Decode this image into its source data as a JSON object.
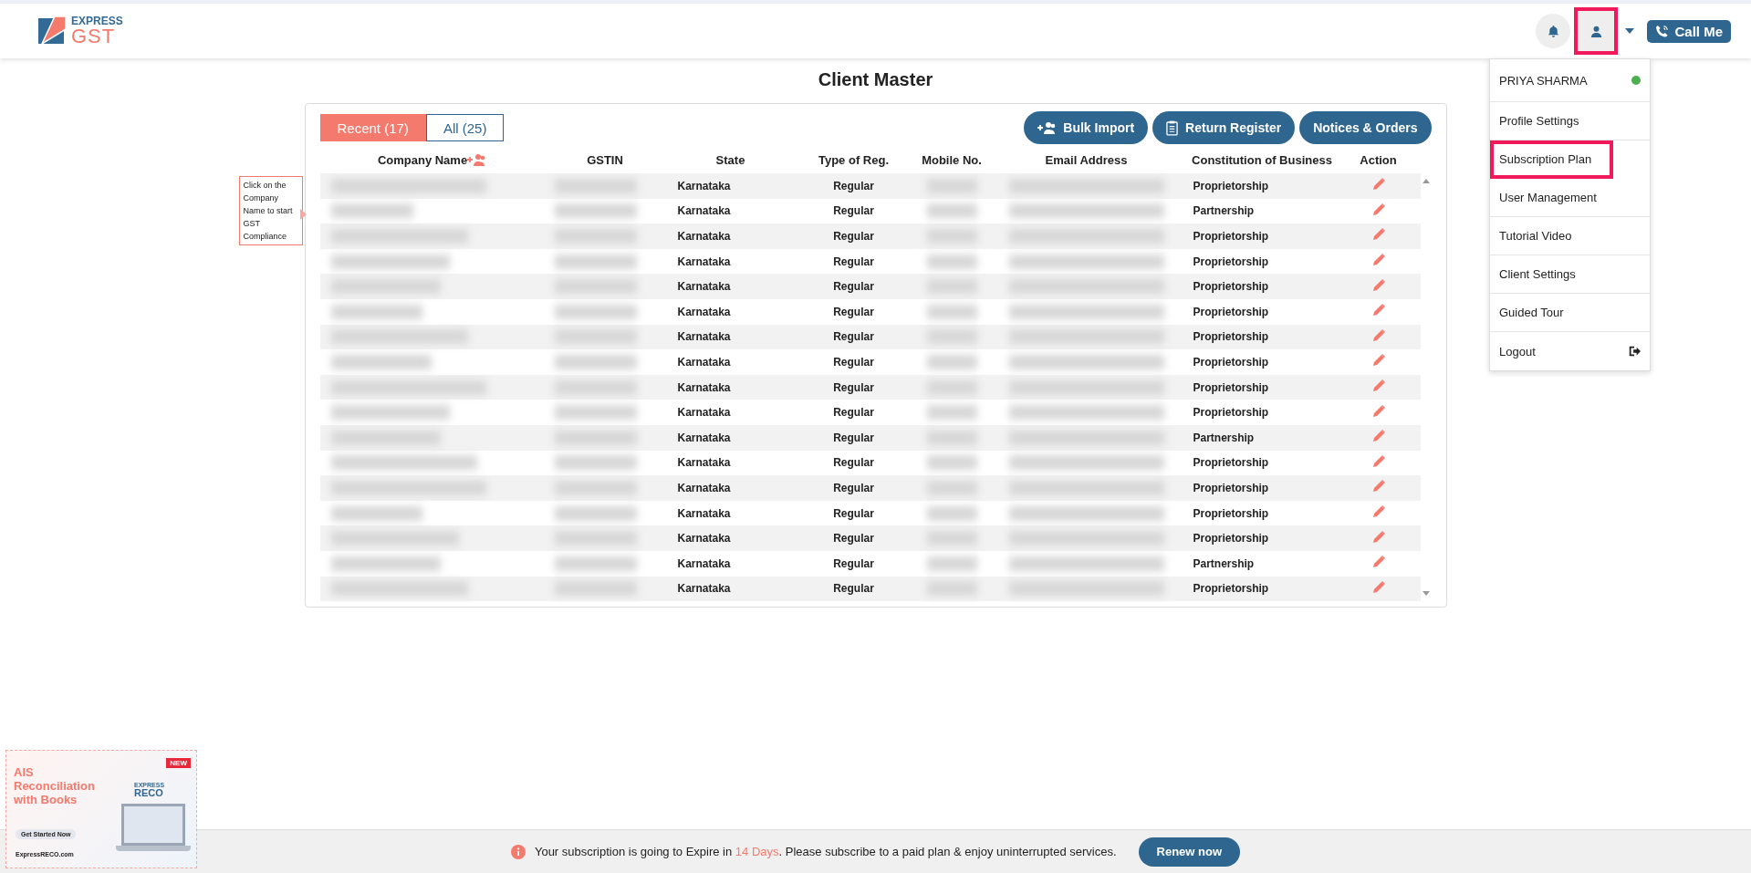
{
  "header": {
    "logo": {
      "top": "EXPRESS",
      "bottom": "GST"
    },
    "user_button": {
      "highlighted": true
    },
    "call_button": "Call Me"
  },
  "user_menu": {
    "name": "PRIYA SHARMA",
    "online": true,
    "items": [
      {
        "label": "Profile Settings",
        "highlighted": false,
        "kind": "link"
      },
      {
        "label": "Subscription Plan",
        "highlighted": true,
        "kind": "link"
      },
      {
        "label": "User Management",
        "highlighted": false,
        "kind": "link"
      },
      {
        "label": "Tutorial Video",
        "highlighted": false,
        "kind": "link"
      },
      {
        "label": "Client Settings",
        "highlighted": false,
        "kind": "link"
      },
      {
        "label": "Guided Tour",
        "highlighted": false,
        "kind": "link"
      },
      {
        "label": "Logout",
        "highlighted": false,
        "kind": "logout"
      }
    ]
  },
  "page_title": "Client Master",
  "tabs": [
    {
      "label": "Recent (17)",
      "selected": true
    },
    {
      "label": "All (25)",
      "selected": false
    }
  ],
  "actions": [
    {
      "label": "Bulk Import",
      "kind": "import"
    },
    {
      "label": "Return Register",
      "kind": "register"
    },
    {
      "label": "Notices & Orders",
      "kind": "plain"
    }
  ],
  "hint": "Click on the Company Name to start GST Compliance",
  "table": {
    "columns": [
      "Company Name",
      "GSTIN",
      "State",
      "Type of Reg.",
      "Mobile No.",
      "Email Address",
      "Constitution of Business",
      "Action"
    ],
    "rows": [
      {
        "state": "Karnataka",
        "type": "Regular",
        "constitution": "Proprietorship"
      },
      {
        "state": "Karnataka",
        "type": "Regular",
        "constitution": "Partnership"
      },
      {
        "state": "Karnataka",
        "type": "Regular",
        "constitution": "Proprietorship"
      },
      {
        "state": "Karnataka",
        "type": "Regular",
        "constitution": "Proprietorship"
      },
      {
        "state": "Karnataka",
        "type": "Regular",
        "constitution": "Proprietorship"
      },
      {
        "state": "Karnataka",
        "type": "Regular",
        "constitution": "Proprietorship"
      },
      {
        "state": "Karnataka",
        "type": "Regular",
        "constitution": "Proprietorship"
      },
      {
        "state": "Karnataka",
        "type": "Regular",
        "constitution": "Proprietorship"
      },
      {
        "state": "Karnataka",
        "type": "Regular",
        "constitution": "Proprietorship"
      },
      {
        "state": "Karnataka",
        "type": "Regular",
        "constitution": "Proprietorship"
      },
      {
        "state": "Karnataka",
        "type": "Regular",
        "constitution": "Partnership"
      },
      {
        "state": "Karnataka",
        "type": "Regular",
        "constitution": "Proprietorship"
      },
      {
        "state": "Karnataka",
        "type": "Regular",
        "constitution": "Proprietorship"
      },
      {
        "state": "Karnataka",
        "type": "Regular",
        "constitution": "Proprietorship"
      },
      {
        "state": "Karnataka",
        "type": "Regular",
        "constitution": "Proprietorship"
      },
      {
        "state": "Karnataka",
        "type": "Regular",
        "constitution": "Partnership"
      },
      {
        "state": "Karnataka",
        "type": "Regular",
        "constitution": "Proprietorship"
      }
    ]
  },
  "promo": {
    "badge": "NEW",
    "headline": "AIS Reconciliation with Books",
    "brand_top": "EXPRESS",
    "brand_bottom": "RECO",
    "cta": "Get Started Now",
    "site": "ExpressRECO.com"
  },
  "banner": {
    "message": "Your subscription is going to Expire in **14 Days**. Please subscribe to a paid plan & enjoy uninterrupted services.",
    "button": "Renew now"
  }
}
